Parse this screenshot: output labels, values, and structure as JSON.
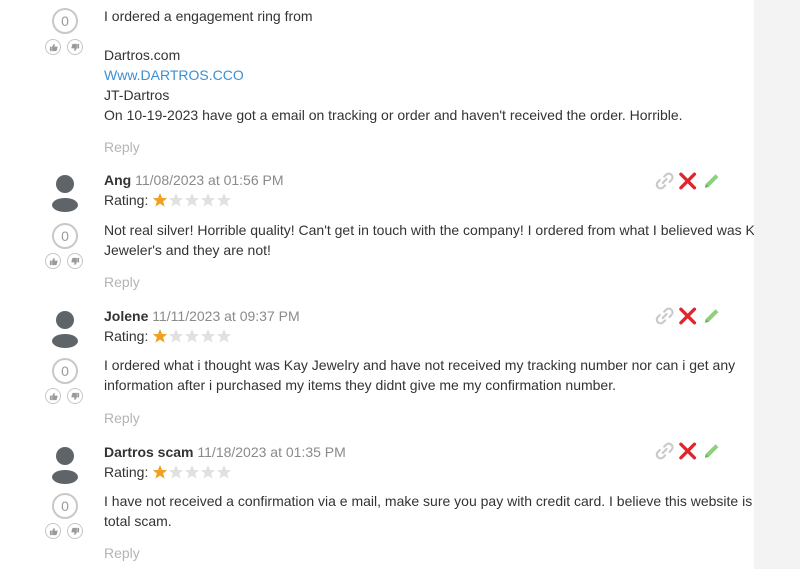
{
  "comments": [
    {
      "votes": "0",
      "lines": [
        "I ordered a engagement ring from",
        "",
        "Dartros.com",
        "Www.DARTROS.CCO",
        "JT-Dartros",
        "On 10-19-2023 have got a email on tracking or order and haven't received the order. Horrible."
      ],
      "reply": "Reply"
    },
    {
      "author": "Ang",
      "date": "11/08/2023 at 01:56 PM",
      "rating_label": "Rating:",
      "rating": 1,
      "rating_max": 5,
      "votes": "0",
      "lines": [
        "Not real silver! Horrible quality! Can't get in touch with the company! I ordered from what I believed was Kay",
        "Jeweler's and they are not!"
      ],
      "reply": "Reply"
    },
    {
      "author": "Jolene",
      "date": "11/11/2023 at 09:37 PM",
      "rating_label": "Rating:",
      "rating": 1,
      "rating_max": 5,
      "votes": "0",
      "lines": [
        "I ordered what i thought was Kay Jewelry and have not received my tracking number nor can i get any",
        "information after i purchased my items they didnt give me my confirmation number."
      ],
      "reply": "Reply"
    },
    {
      "author": "Dartros scam",
      "date": "11/18/2023 at 01:35 PM",
      "rating_label": "Rating:",
      "rating": 1,
      "rating_max": 5,
      "votes": "0",
      "lines": [
        "I have not received a confirmation via e mail, make sure you pay with credit card. I believe this website is a",
        "total scam."
      ],
      "reply": "Reply"
    }
  ],
  "icons": {
    "avatar": "user-silhouette-icon",
    "thumbs_up": "thumbs-up-icon",
    "thumbs_down": "thumbs-down-icon",
    "link": "link-icon",
    "delete": "delete-x-icon",
    "edit": "pencil-edit-icon",
    "star": "star-icon"
  },
  "colors": {
    "link": "#3c8fd1",
    "star_filled": "#f0a01e",
    "star_empty": "#e0e0e0",
    "delete": "#e0262d",
    "edit": "#8fd07e",
    "reply": "#b4b4b4"
  }
}
